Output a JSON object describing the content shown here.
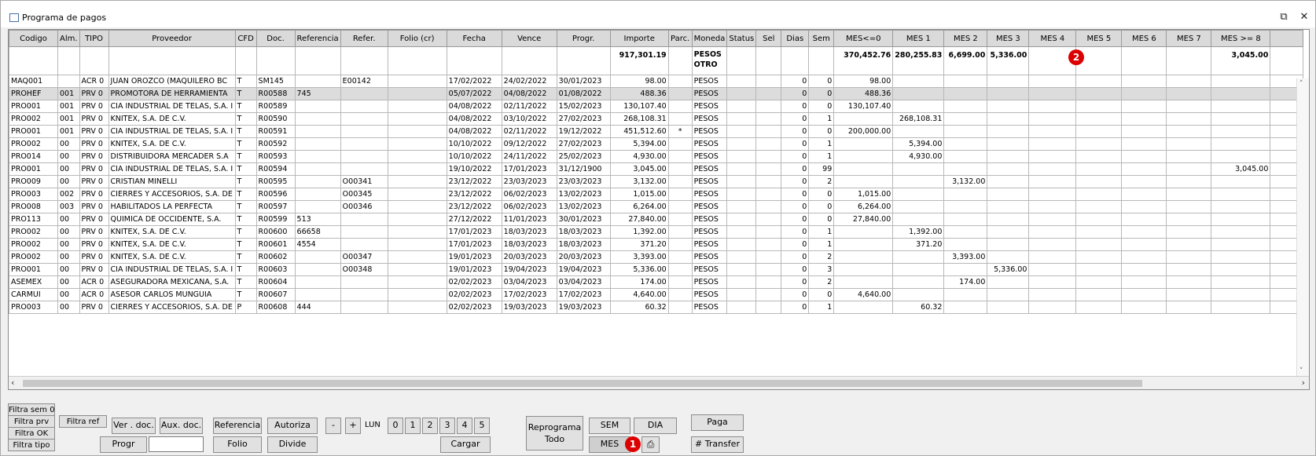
{
  "window": {
    "title": "Programa de pagos",
    "restore_icon": "restore-icon",
    "close_icon": "close-icon"
  },
  "grid": {
    "columns": [
      "Codigo",
      "Alm.",
      "TIPO",
      "Proveedor",
      "CFD",
      "Doc.",
      "Referencia",
      "Refer.",
      "Folio (cr)",
      "Fecha",
      "Vence",
      "Progr.",
      "Importe",
      "Parc.",
      "Moneda",
      "Status",
      "Sel",
      "Dias",
      "Sem",
      "MES<=0",
      "MES 1",
      "MES 2",
      "MES 3",
      "MES 4",
      "MES 5",
      "MES 6",
      "MES 7",
      "MES >= 8",
      ""
    ],
    "totals": [
      "",
      "",
      "",
      "",
      "",
      "",
      "",
      "",
      "",
      "",
      "",
      "",
      "917,301.19",
      "",
      "PESOS OTRO",
      "",
      "",
      "",
      "",
      "370,452.76",
      "280,255.83",
      "6,699.00",
      "5,336.00",
      "",
      "",
      "",
      "",
      "3,045.00",
      ""
    ],
    "rows": [
      [
        "MAQ001",
        "",
        "ACR 0",
        "JUAN OROZCO (MAQUILERO BC",
        "T",
        "SM145",
        "",
        "E00142",
        "",
        "17/02/2022",
        "24/02/2022",
        "30/01/2023",
        "98.00",
        "",
        "PESOS",
        "",
        "",
        "0",
        "0",
        "98.00",
        "",
        "",
        "",
        "",
        "",
        "",
        "",
        "",
        ""
      ],
      [
        "PROHEF",
        "001",
        "PRV 0",
        "PROMOTORA DE HERRAMIENTA",
        "T",
        "R00588",
        "745",
        "",
        "",
        "05/07/2022",
        "04/08/2022",
        "01/08/2022",
        "488.36",
        "",
        "PESOS",
        "",
        "",
        "0",
        "0",
        "488.36",
        "",
        "",
        "",
        "",
        "",
        "",
        "",
        "",
        ""
      ],
      [
        "PRO001",
        "001",
        "PRV 0",
        "CIA INDUSTRIAL DE TELAS, S.A. I",
        "T",
        "R00589",
        "",
        "",
        "",
        "04/08/2022",
        "02/11/2022",
        "15/02/2023",
        "130,107.40",
        "",
        "PESOS",
        "",
        "",
        "0",
        "0",
        "130,107.40",
        "",
        "",
        "",
        "",
        "",
        "",
        "",
        "",
        ""
      ],
      [
        "PRO002",
        "001",
        "PRV 0",
        "KNITEX, S.A. DE C.V.",
        "T",
        "R00590",
        "",
        "",
        "",
        "04/08/2022",
        "03/10/2022",
        "27/02/2023",
        "268,108.31",
        "",
        "PESOS",
        "",
        "",
        "0",
        "1",
        "",
        "268,108.31",
        "",
        "",
        "",
        "",
        "",
        "",
        "",
        ""
      ],
      [
        "PRO001",
        "001",
        "PRV 0",
        "CIA INDUSTRIAL DE TELAS, S.A. I",
        "T",
        "R00591",
        "",
        "",
        "",
        "04/08/2022",
        "02/11/2022",
        "19/12/2022",
        "451,512.60",
        "*",
        "PESOS",
        "",
        "",
        "0",
        "0",
        "200,000.00",
        "",
        "",
        "",
        "",
        "",
        "",
        "",
        "",
        ""
      ],
      [
        "PRO002",
        "00",
        "PRV 0",
        "KNITEX, S.A. DE C.V.",
        "T",
        "R00592",
        "",
        "",
        "",
        "10/10/2022",
        "09/12/2022",
        "27/02/2023",
        "5,394.00",
        "",
        "PESOS",
        "",
        "",
        "0",
        "1",
        "",
        "5,394.00",
        "",
        "",
        "",
        "",
        "",
        "",
        "",
        ""
      ],
      [
        "PRO014",
        "00",
        "PRV 0",
        "DISTRIBUIDORA MERCADER S.A",
        "T",
        "R00593",
        "",
        "",
        "",
        "10/10/2022",
        "24/11/2022",
        "25/02/2023",
        "4,930.00",
        "",
        "PESOS",
        "",
        "",
        "0",
        "1",
        "",
        "4,930.00",
        "",
        "",
        "",
        "",
        "",
        "",
        "",
        ""
      ],
      [
        "PRO001",
        "00",
        "PRV 0",
        "CIA INDUSTRIAL DE TELAS, S.A. I",
        "T",
        "R00594",
        "",
        "",
        "",
        "19/10/2022",
        "17/01/2023",
        "31/12/1900",
        "3,045.00",
        "",
        "PESOS",
        "",
        "",
        "0",
        "99",
        "",
        "",
        "",
        "",
        "",
        "",
        "",
        "",
        "3,045.00",
        ""
      ],
      [
        "PRO009",
        "00",
        "PRV 0",
        "CRISTIAN MINELLI",
        "T",
        "R00595",
        "",
        "O00341",
        "",
        "23/12/2022",
        "23/03/2023",
        "23/03/2023",
        "3,132.00",
        "",
        "PESOS",
        "",
        "",
        "0",
        "2",
        "",
        "",
        "3,132.00",
        "",
        "",
        "",
        "",
        "",
        "",
        ""
      ],
      [
        "PRO003",
        "002",
        "PRV 0",
        "CIERRES Y ACCESORIOS, S.A. DE",
        "T",
        "R00596",
        "",
        "O00345",
        "",
        "23/12/2022",
        "06/02/2023",
        "13/02/2023",
        "1,015.00",
        "",
        "PESOS",
        "",
        "",
        "0",
        "0",
        "1,015.00",
        "",
        "",
        "",
        "",
        "",
        "",
        "",
        "",
        ""
      ],
      [
        "PRO008",
        "003",
        "PRV 0",
        "HABILITADOS LA PERFECTA",
        "T",
        "R00597",
        "",
        "O00346",
        "",
        "23/12/2022",
        "06/02/2023",
        "13/02/2023",
        "6,264.00",
        "",
        "PESOS",
        "",
        "",
        "0",
        "0",
        "6,264.00",
        "",
        "",
        "",
        "",
        "",
        "",
        "",
        "",
        ""
      ],
      [
        "PRO113",
        "00",
        "PRV 0",
        "QUIMICA DE OCCIDENTE, S.A.",
        "T",
        "R00599",
        "513",
        "",
        "",
        "27/12/2022",
        "11/01/2023",
        "30/01/2023",
        "27,840.00",
        "",
        "PESOS",
        "",
        "",
        "0",
        "0",
        "27,840.00",
        "",
        "",
        "",
        "",
        "",
        "",
        "",
        "",
        ""
      ],
      [
        "PRO002",
        "00",
        "PRV 0",
        "KNITEX, S.A. DE C.V.",
        "T",
        "R00600",
        "66658",
        "",
        "",
        "17/01/2023",
        "18/03/2023",
        "18/03/2023",
        "1,392.00",
        "",
        "PESOS",
        "",
        "",
        "0",
        "1",
        "",
        "1,392.00",
        "",
        "",
        "",
        "",
        "",
        "",
        "",
        ""
      ],
      [
        "PRO002",
        "00",
        "PRV 0",
        "KNITEX, S.A. DE C.V.",
        "T",
        "R00601",
        "4554",
        "",
        "",
        "17/01/2023",
        "18/03/2023",
        "18/03/2023",
        "371.20",
        "",
        "PESOS",
        "",
        "",
        "0",
        "1",
        "",
        "371.20",
        "",
        "",
        "",
        "",
        "",
        "",
        "",
        ""
      ],
      [
        "PRO002",
        "00",
        "PRV 0",
        "KNITEX, S.A. DE C.V.",
        "T",
        "R00602",
        "",
        "O00347",
        "",
        "19/01/2023",
        "20/03/2023",
        "20/03/2023",
        "3,393.00",
        "",
        "PESOS",
        "",
        "",
        "0",
        "2",
        "",
        "",
        "3,393.00",
        "",
        "",
        "",
        "",
        "",
        "",
        ""
      ],
      [
        "PRO001",
        "00",
        "PRV 0",
        "CIA INDUSTRIAL DE TELAS, S.A. I",
        "T",
        "R00603",
        "",
        "O00348",
        "",
        "19/01/2023",
        "19/04/2023",
        "19/04/2023",
        "5,336.00",
        "",
        "PESOS",
        "",
        "",
        "0",
        "3",
        "",
        "",
        "",
        "5,336.00",
        "",
        "",
        "",
        "",
        "",
        ""
      ],
      [
        "ASEMEX",
        "00",
        "ACR 0",
        "ASEGURADORA MEXICANA, S.A.",
        "T",
        "R00604",
        "",
        "",
        "",
        "02/02/2023",
        "03/04/2023",
        "03/04/2023",
        "174.00",
        "",
        "PESOS",
        "",
        "",
        "0",
        "2",
        "",
        "",
        "174.00",
        "",
        "",
        "",
        "",
        "",
        "",
        ""
      ],
      [
        "CARMUI",
        "00",
        "ACR 0",
        "ASESOR CARLOS MUNGUIA",
        "T",
        "R00607",
        "",
        "",
        "",
        "02/02/2023",
        "17/02/2023",
        "17/02/2023",
        "4,640.00",
        "",
        "PESOS",
        "",
        "",
        "0",
        "0",
        "4,640.00",
        "",
        "",
        "",
        "",
        "",
        "",
        "",
        "",
        ""
      ],
      [
        "PRO003",
        "00",
        "PRV 0",
        "CIERRES Y ACCESORIOS, S.A. DE",
        "P",
        "R00608",
        "444",
        "",
        "",
        "02/02/2023",
        "19/03/2023",
        "19/03/2023",
        "60.32",
        "",
        "PESOS",
        "",
        "",
        "0",
        "1",
        "",
        "60.32",
        "",
        "",
        "",
        "",
        "",
        "",
        "",
        ""
      ]
    ]
  },
  "buttons": {
    "filtra_sem": "Filtra sem 0",
    "filtra_prv": "Filtra prv",
    "filtra_ok": "Filtra OK",
    "filtra_tipo": "Filtra tipo",
    "filtra_ref": "Filtra ref",
    "ver_doc": "Ver . doc.",
    "aux_doc": "Aux. doc.",
    "progr": "Progr",
    "referencia": "Referencia",
    "folio": "Folio",
    "autoriza": "Autoriza",
    "divide": "Divide",
    "minus": "-",
    "plus": "+",
    "lun": "LUN",
    "days": [
      "0",
      "1",
      "2",
      "3",
      "4",
      "5"
    ],
    "cargar": "Cargar",
    "reprograma": "Reprograma Todo",
    "sem": "SEM",
    "dia": "DIA",
    "mes": "MES",
    "paga": "Paga",
    "transfer": "# Transfer"
  },
  "progr_input": {
    "value": ""
  },
  "annotations": [
    "1",
    "2"
  ],
  "colors": {
    "badge": "#dd0000",
    "selected_row": "#dcdcdc",
    "header": "#dadada"
  }
}
